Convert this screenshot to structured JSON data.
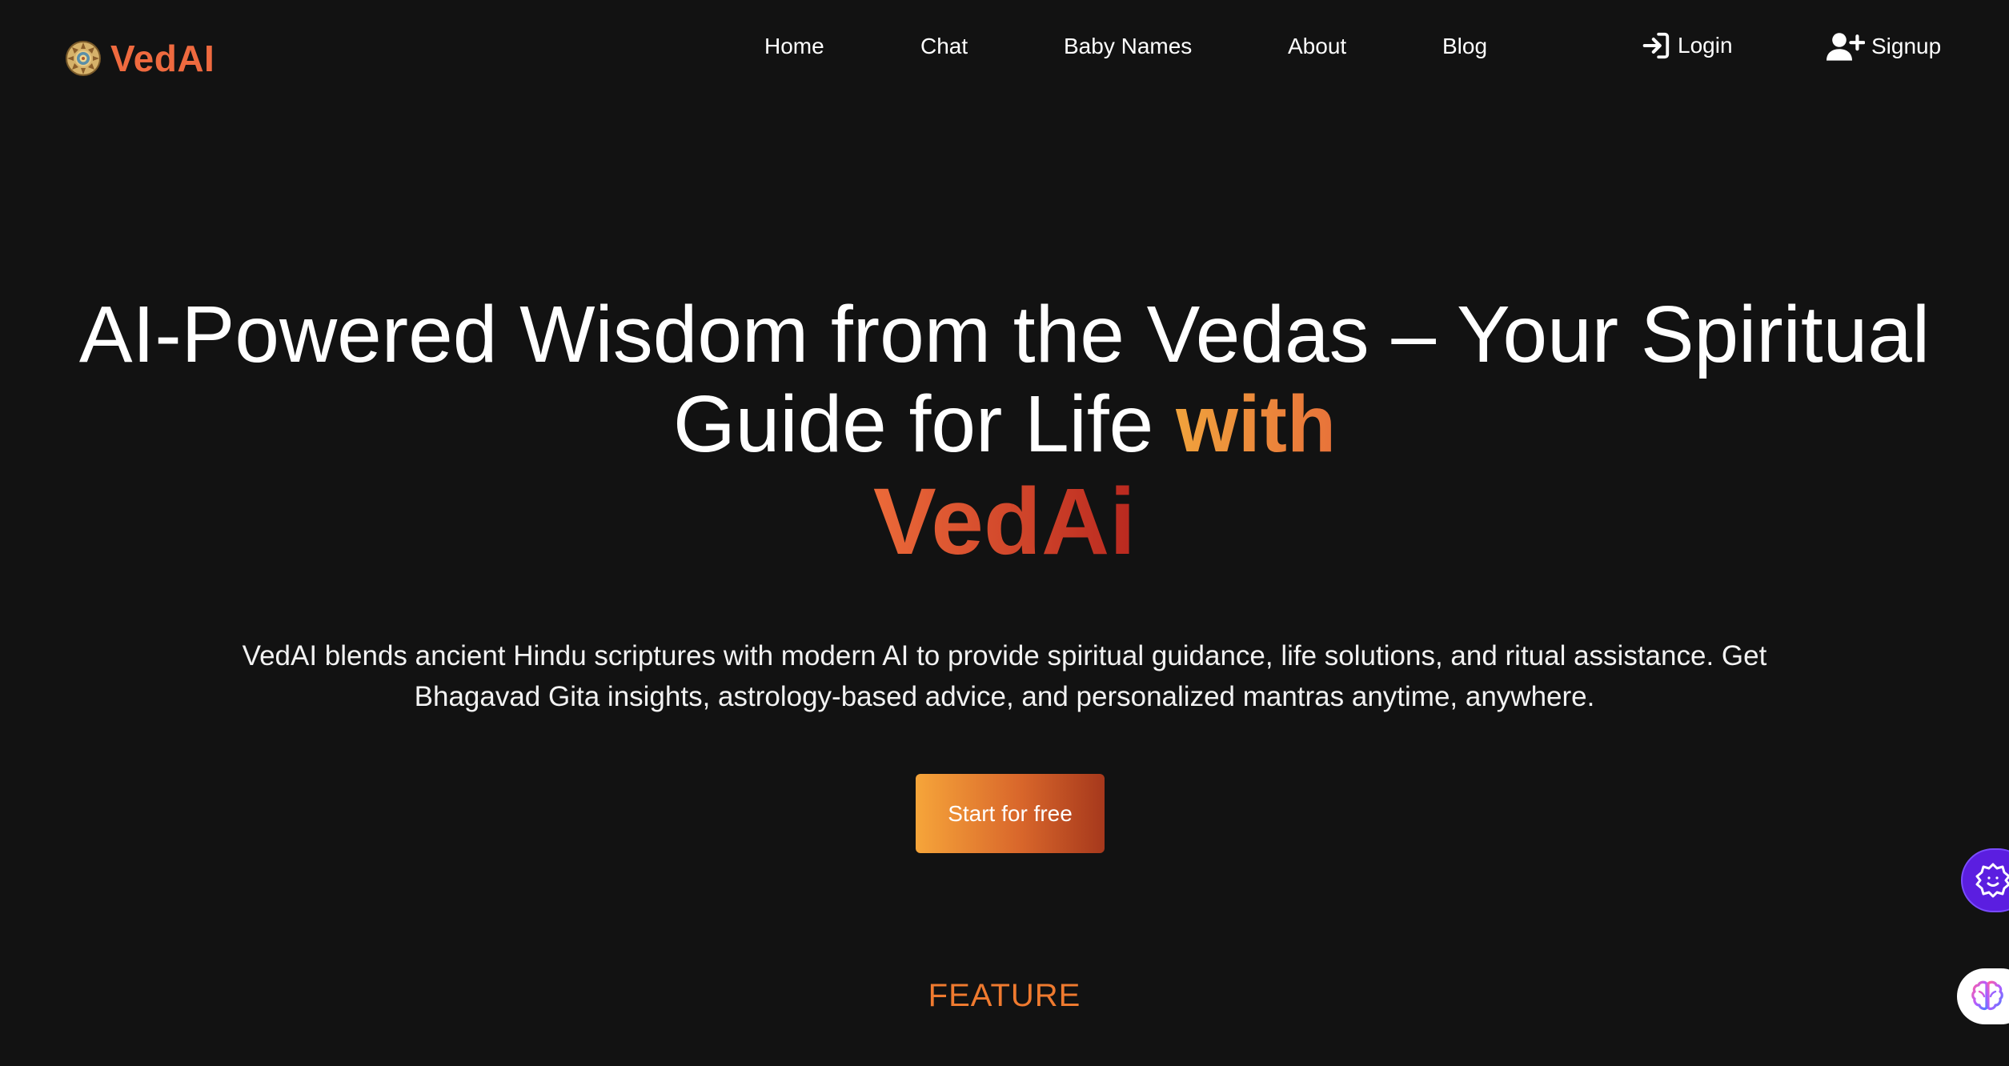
{
  "brand": {
    "name": "VedAI",
    "logo_icon": "mandala-logo-icon",
    "color": "#ef6a3f"
  },
  "nav": {
    "items": [
      {
        "label": "Home"
      },
      {
        "label": "Chat"
      },
      {
        "label": "Baby Names"
      },
      {
        "label": "About"
      },
      {
        "label": "Blog"
      }
    ],
    "login": {
      "label": "Login",
      "icon": "login-arrow-icon"
    },
    "signup": {
      "label": "Signup",
      "icon": "user-plus-icon"
    }
  },
  "hero": {
    "title_main": "AI-Powered Wisdom from the Vedas – Your Spiritual Guide for Life ",
    "title_accent": "with",
    "title_brand": "VedAi",
    "description": "VedAI blends ancient Hindu scriptures with modern AI to provide spiritual guidance, life solutions, and ritual assistance. Get Bhagavad Gita insights, astrology-based advice, and personalized mantras anytime, anywhere.",
    "cta_label": "Start for free"
  },
  "section": {
    "feature_label": "FEATURE"
  },
  "widgets": {
    "settings_icon": "gear-face-icon",
    "brain_icon": "brain-icon",
    "settings_color": "#5b1ee0"
  },
  "colors": {
    "background": "#121212",
    "accent_orange": "#ef7a2f",
    "accent_red": "#b9281f"
  }
}
